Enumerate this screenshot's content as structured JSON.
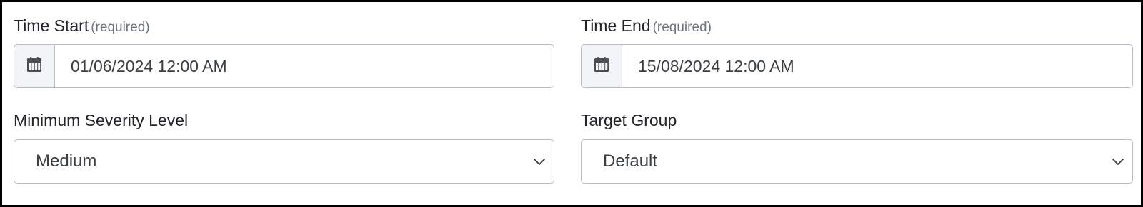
{
  "time_start": {
    "label": "Time Start",
    "required_note": "(required)",
    "icon": "calendar-icon",
    "value": "01/06/2024 12:00 AM"
  },
  "time_end": {
    "label": "Time End",
    "required_note": "(required)",
    "icon": "calendar-icon",
    "value": "15/08/2024 12:00 AM"
  },
  "min_severity": {
    "label": "Minimum Severity Level",
    "selected": "Medium",
    "icon": "chevron-down-icon"
  },
  "target_group": {
    "label": "Target Group",
    "selected": "Default",
    "icon": "chevron-down-icon"
  },
  "colors": {
    "border": "#b8bec5",
    "addon_background": "#f1f3f6",
    "label_text": "#212529",
    "required_text": "#6c757d",
    "frame_border": "#000000"
  }
}
